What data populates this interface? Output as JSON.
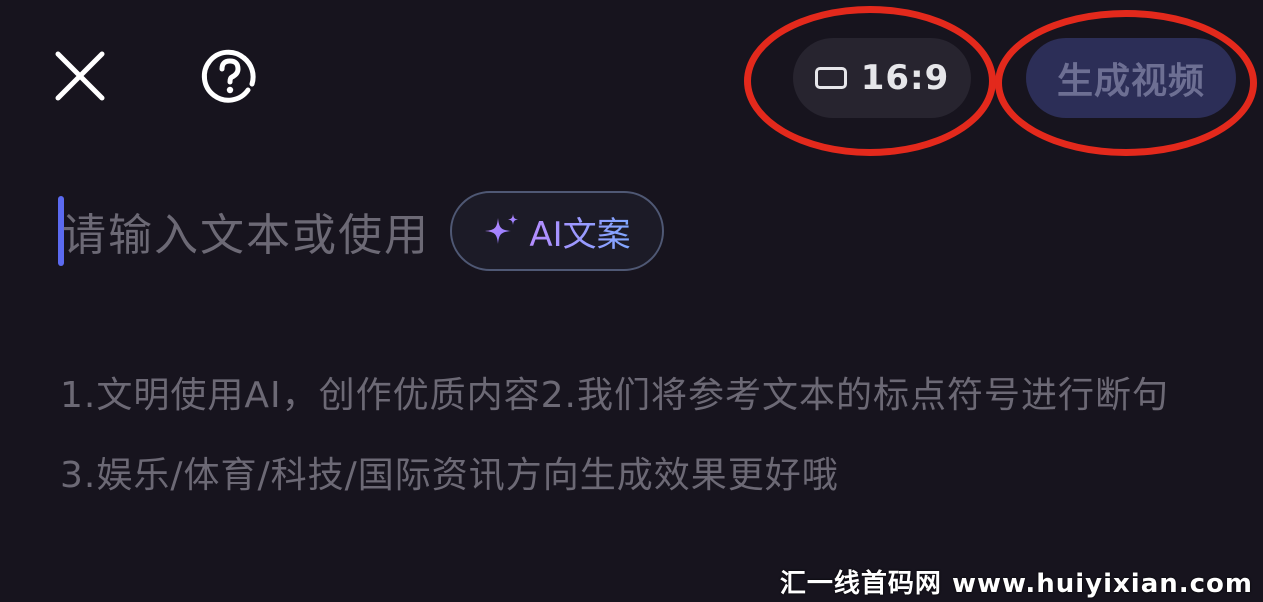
{
  "header": {
    "close_icon": "close-icon",
    "help_icon": "help-question-icon",
    "aspect_ratio": {
      "icon": "aspect-ratio-rectangle-icon",
      "label": "16:9"
    },
    "generate_button": {
      "label": "生成视频",
      "state": "disabled"
    }
  },
  "editor": {
    "placeholder": "请输入文本或使用",
    "ai_button": {
      "icon": "sparkle-icon",
      "label": "AI文案"
    }
  },
  "hint": "1.文明使用AI，创作优质内容2.我们将参考文本的标点符号进行断句3.娱乐/体育/科技/国际资讯方向生成效果更好哦",
  "watermark": "汇一线首码网 www.huiyixian.com",
  "colors": {
    "background": "#17141e",
    "annotation": "#e3291c",
    "accent": "#5b6af0",
    "generate_button": "#2c2e57"
  }
}
